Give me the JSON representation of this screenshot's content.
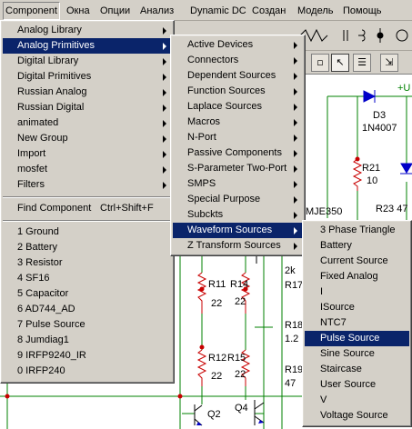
{
  "menubar": [
    "Component",
    "Окна",
    "Опции",
    "Анализ",
    "Dynamic DC",
    "Создан",
    "Модель",
    "Помощь"
  ],
  "menu_component": {
    "items": [
      {
        "label": "Analog Library",
        "submenu": true
      },
      {
        "label": "Analog Primitives",
        "submenu": true,
        "highlighted": true
      },
      {
        "label": "Digital Library",
        "submenu": true
      },
      {
        "label": "Digital Primitives",
        "submenu": true
      },
      {
        "label": "Russian Analog",
        "submenu": true
      },
      {
        "label": "Russian Digital",
        "submenu": true
      },
      {
        "label": "animated",
        "submenu": true
      },
      {
        "label": "New Group",
        "submenu": true
      },
      {
        "label": "Import",
        "submenu": true
      },
      {
        "label": "mosfet",
        "submenu": true
      },
      {
        "label": "Filters",
        "submenu": true
      }
    ],
    "find": {
      "label": "Find Component",
      "shortcut": "Ctrl+Shift+F"
    },
    "recent": [
      "1 Ground",
      "2 Battery",
      "3 Resistor",
      "4 SF16",
      "5 Capacitor",
      "6 AD744_AD",
      "7 Pulse Source",
      "8 Jumdiag1",
      "9 IRFP9240_IR",
      "0 IRFP240"
    ]
  },
  "menu_analog_primitives": {
    "items": [
      {
        "label": "Active Devices",
        "submenu": true
      },
      {
        "label": "Connectors",
        "submenu": true
      },
      {
        "label": "Dependent Sources",
        "submenu": true
      },
      {
        "label": "Function Sources",
        "submenu": true
      },
      {
        "label": "Laplace Sources",
        "submenu": true
      },
      {
        "label": "Macros",
        "submenu": true
      },
      {
        "label": "N-Port",
        "submenu": true
      },
      {
        "label": "Passive Components",
        "submenu": true
      },
      {
        "label": "S-Parameter Two-Port",
        "submenu": true
      },
      {
        "label": "SMPS",
        "submenu": true
      },
      {
        "label": "Special Purpose",
        "submenu": true
      },
      {
        "label": "Subckts",
        "submenu": true
      },
      {
        "label": "Waveform Sources",
        "submenu": true,
        "highlighted": true
      },
      {
        "label": "Z Transform Sources",
        "submenu": true
      }
    ]
  },
  "menu_waveform_sources": {
    "items": [
      {
        "label": "3 Phase Triangle"
      },
      {
        "label": "Battery"
      },
      {
        "label": "Current Source"
      },
      {
        "label": "Fixed Analog"
      },
      {
        "label": "I"
      },
      {
        "label": "ISource"
      },
      {
        "label": "NTC7"
      },
      {
        "label": "Pulse Source",
        "highlighted": true
      },
      {
        "label": "Sine Source"
      },
      {
        "label": "Staircase"
      },
      {
        "label": "User Source"
      },
      {
        "label": "V"
      },
      {
        "label": "Voltage Source"
      }
    ]
  },
  "schematic": {
    "labels": {
      "plus_u": "+U",
      "d3": "D3",
      "d3_part": "1N4007",
      "r21": "R21",
      "r21_val": "10",
      "r23": "R23 47",
      "mje": "MJE350",
      "r11": "R11",
      "r14": "R14",
      "r11_val": "22",
      "r14_val": "22",
      "r12": "R12",
      "r15": "R15",
      "r12_val": "22",
      "r15_val": "22",
      "q2": "Q2",
      "q4": "Q4",
      "k2": "2k",
      "r17": "R17",
      "r18": "R18",
      "v12": "1.2",
      "r19": "R19",
      "v47": "47"
    },
    "colors": {
      "wire": "#008000",
      "resistor": "#c80000",
      "diode": "#0000c8",
      "text_blue": "#0000c8"
    }
  },
  "toolbar": {
    "icons": [
      "arrow-select-icon",
      "pointer-icon",
      "properties-icon",
      "window-icon"
    ]
  }
}
